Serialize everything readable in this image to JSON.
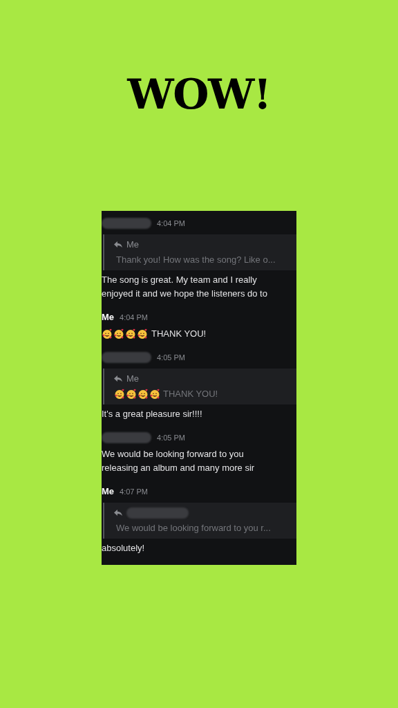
{
  "headline": "WOW!",
  "chat": {
    "messages": [
      {
        "author_hidden": true,
        "time": "4:04 PM",
        "reply": {
          "author_hidden": false,
          "author_text": "Me",
          "text": "Thank you! How was the song? Like o..."
        },
        "lines": [
          "The song is great. My team and I really",
          "enjoyed it and we hope the listeners do to"
        ]
      },
      {
        "author": "Me",
        "author_hidden": false,
        "time": "4:04 PM",
        "emojis": [
          {
            "kind": "hearts_face"
          },
          {
            "kind": "hearts_face"
          },
          {
            "kind": "hearts_face"
          },
          {
            "kind": "hearts_face"
          }
        ],
        "lines": [
          "THANK YOU!"
        ]
      },
      {
        "author_hidden": true,
        "time": "4:05 PM",
        "reply": {
          "author_hidden": false,
          "author_text": "Me",
          "emojis": [
            {
              "kind": "hearts_face"
            },
            {
              "kind": "hearts_face"
            },
            {
              "kind": "hearts_face"
            },
            {
              "kind": "hearts_face"
            }
          ],
          "text": "THANK YOU!"
        },
        "lines": [
          "It's a great pleasure sir!!!!"
        ]
      },
      {
        "author_hidden": true,
        "time": "4:05 PM",
        "lines": [
          "We would be looking forward to you",
          "releasing an album and many more sir"
        ]
      },
      {
        "author": "Me",
        "author_hidden": false,
        "time": "4:07 PM",
        "reply": {
          "author_hidden": true,
          "text": "We would be looking forward to you r..."
        },
        "lines": [
          "absolutely!"
        ]
      }
    ]
  }
}
